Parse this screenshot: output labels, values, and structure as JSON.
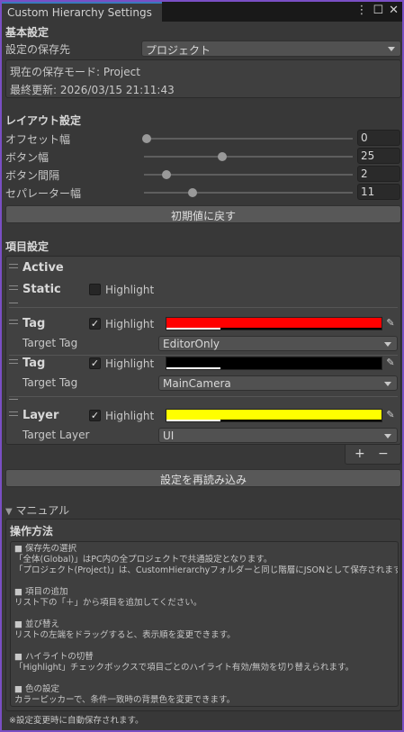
{
  "window": {
    "tab_title": "Custom Hierarchy Settings",
    "menu_icon": "kebab-menu-icon",
    "maximize_icon": "maximize-icon",
    "close_icon": "close-icon"
  },
  "basic": {
    "title": "基本設定",
    "save_location_label": "設定の保存先",
    "save_location_value": "プロジェクト",
    "mode_text": "現在の保存モード: Project",
    "updated_text": "最終更新: 2026/03/15 21:11:43"
  },
  "layout": {
    "title": "レイアウト設定",
    "sliders": [
      {
        "label": "オフセット幅",
        "value": "0",
        "level": 0.0
      },
      {
        "label": "ボタン幅",
        "value": "25",
        "level": 0.38
      },
      {
        "label": "ボタン間隔",
        "value": "2",
        "level": 0.1
      },
      {
        "label": "セパレーター幅",
        "value": "11",
        "level": 0.23
      }
    ],
    "reset_label": "初期値に戻す"
  },
  "items": {
    "title": "項目設定",
    "active_label": "Active",
    "static_label": "Static",
    "highlight_label": "Highlight",
    "entries": [
      {
        "label": "Tag",
        "highlight": true,
        "color": "#ff0000",
        "target_label": "Target Tag",
        "target_value": "EditorOnly"
      },
      {
        "label": "Tag",
        "highlight": true,
        "color": "#000000",
        "target_label": "Target Tag",
        "target_value": "MainCamera"
      },
      {
        "label": "Layer",
        "highlight": true,
        "color": "#ffff00",
        "target_label": "Target Layer",
        "target_value": "UI"
      }
    ],
    "add_label": "+",
    "remove_label": "−",
    "check_mark": "✓"
  },
  "reload_label": "設定を再読み込み",
  "manual": {
    "foldout_label": "マニュアル",
    "title": "操作方法",
    "text": "■ 保存先の選択\n「全体(Global)」はPC内の全プロジェクトで共通設定となります。\n「プロジェクト(Project)」は、CustomHierarchyフォルダーと同じ階層にJSONとして保存されます。\n\n■ 項目の追加\nリスト下の「＋」から項目を追加してください。\n\n■ 並び替え\nリストの左端をドラッグすると、表示順を変更できます。\n\n■ ハイライトの切替\n「Highlight」チェックボックスで項目ごとのハイライト有効/無効を切り替えられます。\n\n■ 色の設定\nカラーピッカーで、条件一致時の背景色を変更できます。",
    "footer": "※設定変更時に自動保存されます。"
  }
}
